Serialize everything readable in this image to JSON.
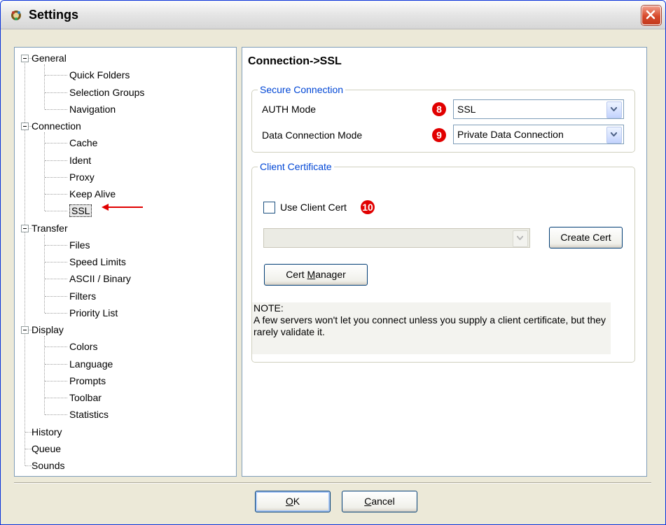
{
  "window": {
    "title": "Settings"
  },
  "tree": {
    "nodes": [
      {
        "label": "General",
        "level": 0,
        "expanded": true
      },
      {
        "label": "Quick Folders",
        "level": 1
      },
      {
        "label": "Selection Groups",
        "level": 1
      },
      {
        "label": "Navigation",
        "level": 1
      },
      {
        "label": "Connection",
        "level": 0,
        "expanded": true
      },
      {
        "label": "Cache",
        "level": 1
      },
      {
        "label": "Ident",
        "level": 1
      },
      {
        "label": "Proxy",
        "level": 1
      },
      {
        "label": "Keep Alive",
        "level": 1
      },
      {
        "label": "SSL",
        "level": 1,
        "selected": true
      },
      {
        "label": "Transfer",
        "level": 0,
        "expanded": true
      },
      {
        "label": "Files",
        "level": 1
      },
      {
        "label": "Speed Limits",
        "level": 1
      },
      {
        "label": "ASCII / Binary",
        "level": 1
      },
      {
        "label": "Filters",
        "level": 1
      },
      {
        "label": "Priority List",
        "level": 1
      },
      {
        "label": "Display",
        "level": 0,
        "expanded": true
      },
      {
        "label": "Colors",
        "level": 1
      },
      {
        "label": "Language",
        "level": 1
      },
      {
        "label": "Prompts",
        "level": 1
      },
      {
        "label": "Toolbar",
        "level": 1
      },
      {
        "label": "Statistics",
        "level": 1
      },
      {
        "label": "History",
        "level": 0
      },
      {
        "label": "Queue",
        "level": 0
      },
      {
        "label": "Sounds",
        "level": 0
      }
    ]
  },
  "panel": {
    "title": "Connection->SSL",
    "secure": {
      "legend": "Secure Connection",
      "auth_label": "AUTH Mode",
      "auth_badge": "8",
      "auth_value": "SSL",
      "data_label": "Data Connection Mode",
      "data_badge": "9",
      "data_value": "Private Data Connection"
    },
    "client": {
      "legend": "Client Certificate",
      "use_cert_label": "Use Client Cert",
      "use_cert_checked": false,
      "use_cert_badge": "10",
      "cert_select_value": "",
      "create_cert": "Create Cert",
      "cert_manager_pre": "Cert ",
      "cert_manager_acc": "M",
      "cert_manager_post": "anager",
      "note_title": "NOTE:",
      "note_body": "A few servers won't let you connect unless you supply a client certificate, but they rarely validate it."
    }
  },
  "footer": {
    "ok_acc": "O",
    "ok_post": "K",
    "cancel_acc": "C",
    "cancel_post": "ancel"
  },
  "colors": {
    "badge": "#e10000",
    "legend": "#0046d5",
    "arrow": "#e00000"
  },
  "icons": [
    "app-icon",
    "close-icon",
    "dropdown-arrow-icon",
    "collapse-icon",
    "red-arrow-icon"
  ]
}
